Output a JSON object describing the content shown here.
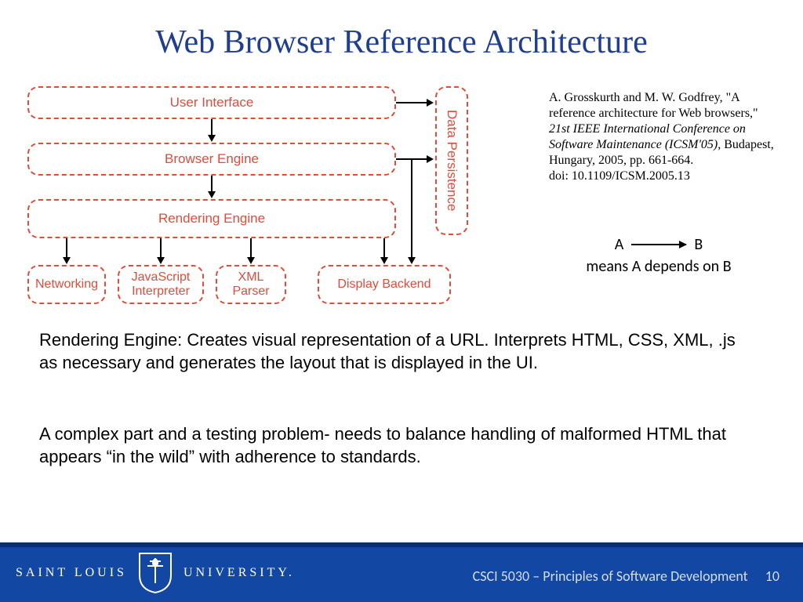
{
  "title": "Web Browser Reference Architecture",
  "diagram": {
    "boxes": {
      "ui": "User Interface",
      "browser_engine": "Browser Engine",
      "rendering_engine": "Rendering Engine",
      "networking": "Networking",
      "js_interpreter": "JavaScript\nInterpreter",
      "xml_parser": "XML\nParser",
      "display_backend": "Display Backend",
      "data_persistence": "Data Persistence"
    }
  },
  "citation": {
    "authors": "A. Grosskurth and M. W. Godfrey, \"A reference architecture for Web browsers,\" ",
    "venue_italic": "21st IEEE International Conference on Software Maintenance (ICSM'05)",
    "rest": ", Budapest, Hungary, 2005, pp. 661-664.",
    "doi": "doi: 10.1109/ICSM.2005.13"
  },
  "legend": {
    "a": "A",
    "b": "B",
    "caption": "means A depends on B"
  },
  "paragraph1": "Rendering Engine: Creates visual representation of a URL. Interprets HTML, CSS, XML, .js as necessary and generates the layout that is displayed in the UI.",
  "paragraph2": "A complex part and a testing problem- needs to balance handling of malformed HTML that appears “in the wild” with adherence to standards.",
  "footer": {
    "course": "CSCI 5030 – Principles of Software Development",
    "page": "10",
    "logo_left": "SAINT LOUIS",
    "logo_right": "UNIVERSITY."
  }
}
